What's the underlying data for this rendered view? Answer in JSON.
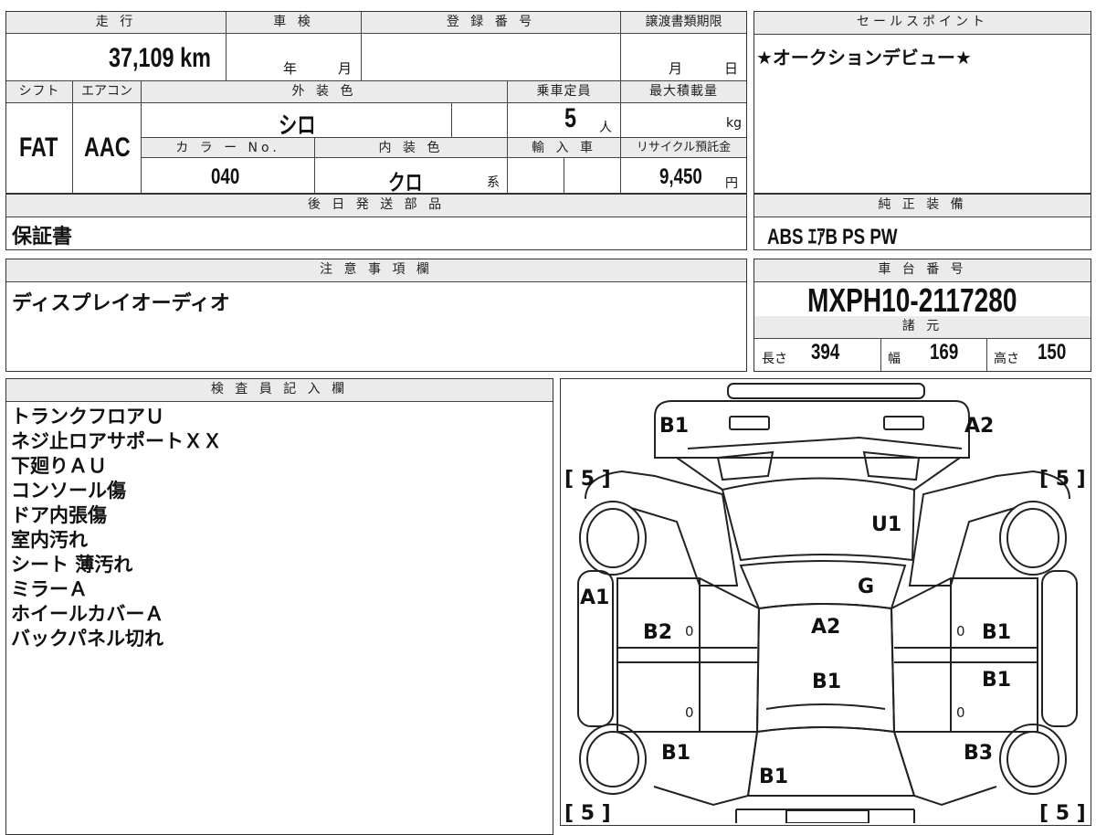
{
  "odometer": {
    "label": "走 行",
    "value": "37,109 km"
  },
  "shaken": {
    "label": "車 検",
    "year_unit": "年",
    "month_unit": "月"
  },
  "registration": {
    "label": "登 録 番 号",
    "value": ""
  },
  "transfer_deadline": {
    "label": "譲渡書類期限",
    "month_unit": "月",
    "day_unit": "日"
  },
  "sales_point": {
    "label": "セールスポイント",
    "value": "★オークションデビュー★"
  },
  "shift": {
    "label": "シフト",
    "value": "FAT"
  },
  "aircon": {
    "label": "エアコン",
    "value": "AAC"
  },
  "exterior_color": {
    "label": "外 装 色",
    "value": "シロ"
  },
  "capacity": {
    "label": "乗車定員",
    "value": "5",
    "unit": "人"
  },
  "max_load": {
    "label": "最大積載量",
    "unit": "kg"
  },
  "color_no": {
    "label": "カ ラ ー No.",
    "value": "040"
  },
  "interior_color": {
    "label": "内 装 色",
    "value": "クロ",
    "suffix": "系"
  },
  "imported": {
    "label": "輸 入 車"
  },
  "recycle": {
    "label": "リサイクル預託金",
    "value": "9,450",
    "unit": "円"
  },
  "later_parts": {
    "label": "後 日 発 送 部 品",
    "value": "保証書"
  },
  "genuine_equipment": {
    "label": "純 正 装 備",
    "value": "ABS ｴｱB PS PW"
  },
  "notes": {
    "label": "注 意 事 項 欄",
    "value": "ディスプレイオーディオ"
  },
  "chassis": {
    "label": "車 台 番 号",
    "value": "MXPH10-2117280"
  },
  "specs": {
    "label": "諸 元",
    "length_label": "長さ",
    "length": "394",
    "width_label": "幅",
    "width": "169",
    "height_label": "高さ",
    "height": "150"
  },
  "inspector": {
    "label": "検 査 員 記 入 欄",
    "items": [
      "トランクフロアＵ",
      "ネジ止ロアサポートＸＸ",
      "下廻りＡＵ",
      "コンソール傷",
      "ドア内張傷",
      "室内汚れ",
      "シート 薄汚れ",
      "ミラーＡ",
      "ホイールカバーＡ",
      "バックパネル切れ"
    ]
  },
  "diagram": {
    "tire_fl": "[ 5 ]",
    "tire_fr": "[ 5 ]",
    "tire_rl": "[ 5 ]",
    "tire_rr": "[ 5 ]",
    "marks": {
      "front_left": "B1",
      "front_right": "A2",
      "hood": "U1",
      "windshield": "G",
      "left_fender": "A1",
      "left_front_door": "B2",
      "roof": "A2",
      "roof_rear": "B1",
      "right_front_door": "B1",
      "right_rear_door": "B1",
      "left_rear_quarter": "B1",
      "right_rear_quarter": "B3",
      "trunk": "B1"
    },
    "zeros": [
      "0",
      "0",
      "0",
      "0"
    ]
  }
}
